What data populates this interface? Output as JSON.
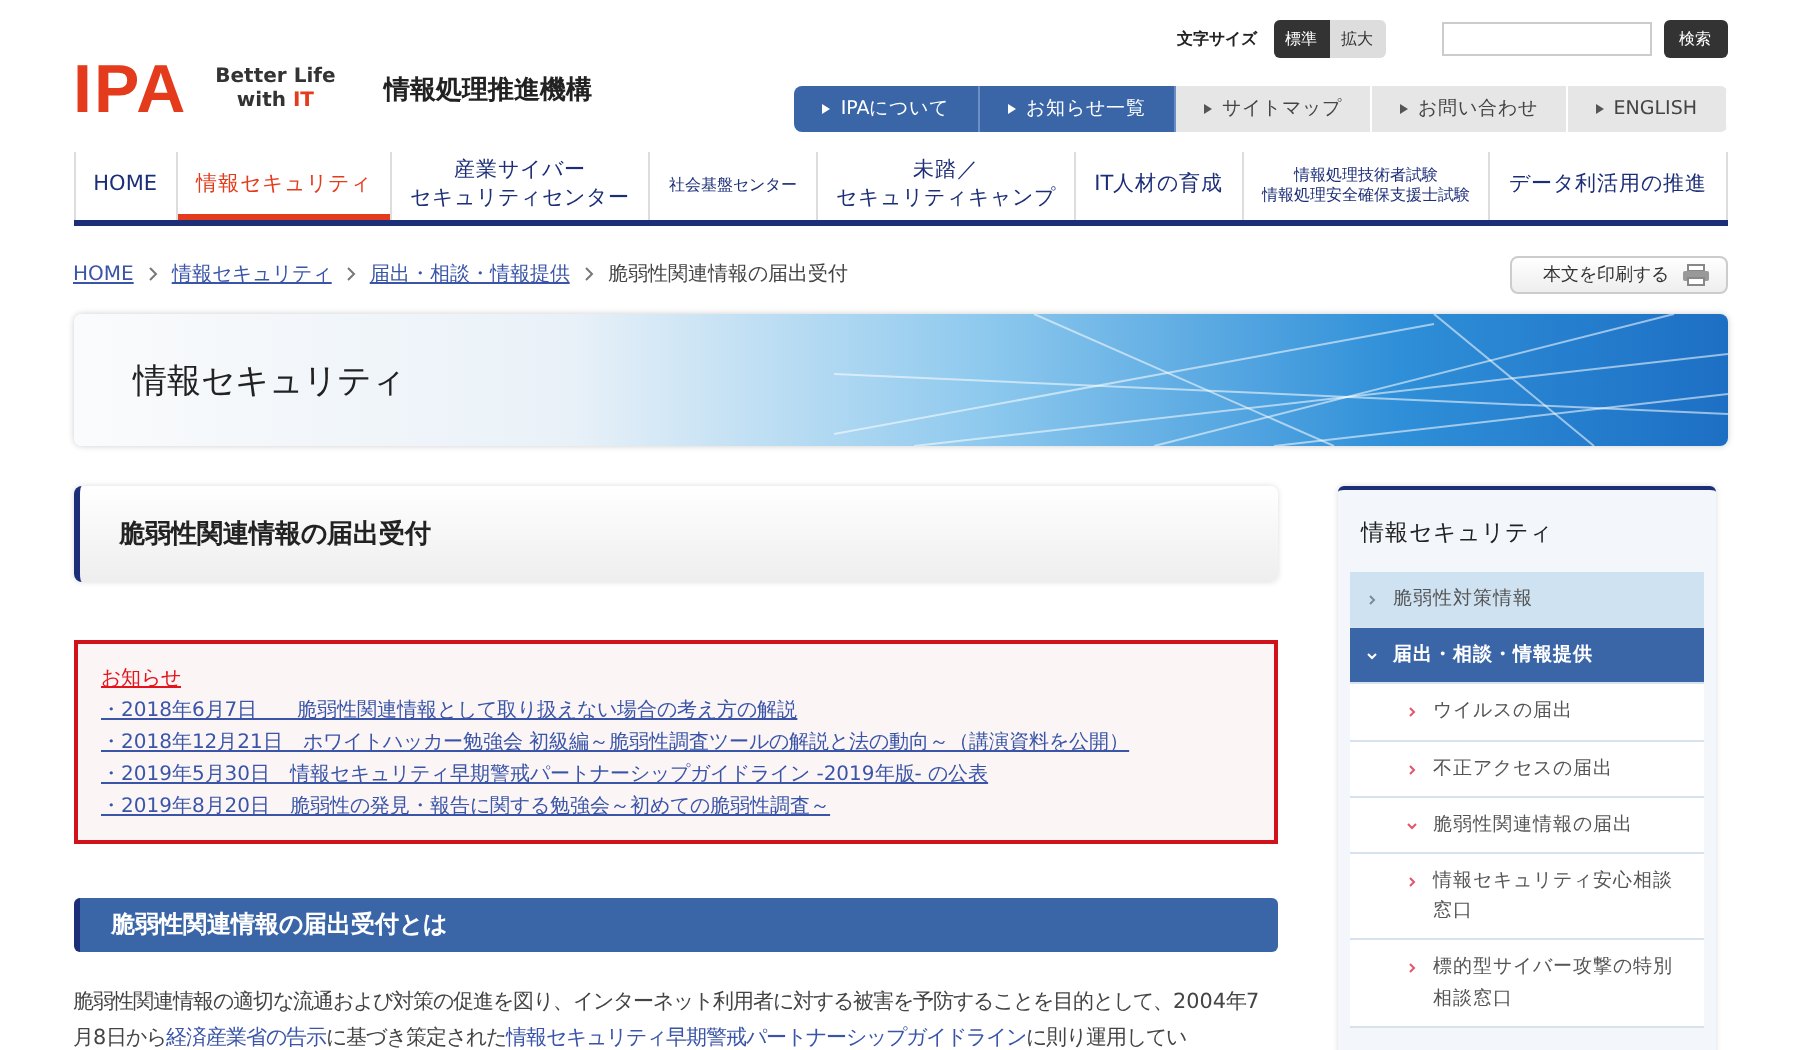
{
  "header": {
    "logo": {
      "mark": "IPA",
      "tagline_1": "Better Life",
      "tagline_2_prefix": "with ",
      "tagline_2_accent": "IT"
    },
    "org_name": "情報処理推進機構",
    "font_size": {
      "label": "文字サイズ",
      "options": [
        {
          "label": "標準",
          "selected": true
        },
        {
          "label": "拡大",
          "selected": false
        }
      ]
    },
    "search": {
      "button": "検索"
    },
    "links": [
      {
        "label": "IPAについて",
        "kind": "primary"
      },
      {
        "label": "お知らせ一覧",
        "kind": "primary"
      },
      {
        "label": "サイトマップ",
        "kind": "secondary"
      },
      {
        "label": "お問い合わせ",
        "kind": "secondary"
      },
      {
        "label": "ENGLISH",
        "kind": "secondary"
      }
    ]
  },
  "nav": [
    {
      "lines": [
        "HOME"
      ],
      "selected": false,
      "kind": "normal"
    },
    {
      "lines": [
        "情報セキュリティ"
      ],
      "selected": true,
      "kind": "normal"
    },
    {
      "lines": [
        "産業サイバー",
        "セキュリティセンター"
      ],
      "selected": false,
      "kind": "normal"
    },
    {
      "lines": [
        "社会基盤センター"
      ],
      "selected": false,
      "kind": "small"
    },
    {
      "lines": [
        "未踏／",
        "セキュリティキャンプ"
      ],
      "selected": false,
      "kind": "normal"
    },
    {
      "lines": [
        "IT人材の育成"
      ],
      "selected": false,
      "kind": "normal"
    },
    {
      "lines": [
        "情報処理技術者試験",
        "情報処理安全確保支援士試験"
      ],
      "selected": false,
      "kind": "small"
    },
    {
      "lines": [
        "データ利活用の推進"
      ],
      "selected": false,
      "kind": "normal"
    }
  ],
  "breadcrumb": [
    {
      "label": "HOME",
      "link": true
    },
    {
      "label": "情報セキュリティ",
      "link": true
    },
    {
      "label": "届出・相談・情報提供",
      "link": true
    },
    {
      "label": "脆弱性関連情報の届出受付",
      "link": false
    }
  ],
  "print_button": "本文を印刷する",
  "banner": {
    "title": "情報セキュリティ"
  },
  "page_title": "脆弱性関連情報の届出受付",
  "notice": {
    "title": "お知らせ",
    "items": [
      "・2018年6月7日　　脆弱性関連情報として取り扱えない場合の考え方の解説",
      "・2018年12月21日　ホワイトハッカー勉強会 初級編～脆弱性調査ツールの解説と法の動向～（講演資料を公開）",
      "・2019年5月30日　情報セキュリティ早期警戒パートナーシップガイドライン -2019年版- の公表",
      "・2019年8月20日　脆弱性の発見・報告に関する勉強会～初めての脆弱性調査～"
    ]
  },
  "section": {
    "heading": "脆弱性関連情報の届出受付とは",
    "paragraph": [
      {
        "text": "脆弱性関連情報の適切な流通および対策の促進を図り、インターネット利用者に対する被害を予防することを目的として、2004年7月8日から",
        "link": false
      },
      {
        "text": "経済産業省の告示",
        "link": true
      },
      {
        "text": "に基づき策定された",
        "link": false
      },
      {
        "text": "情報セキュリティ早期警戒パートナーシップガイドライン",
        "link": true
      },
      {
        "text": "に則り運用してい",
        "link": false
      }
    ]
  },
  "sidebar": {
    "title": "情報セキュリティ",
    "items": [
      {
        "label": "脆弱性対策情報",
        "expanded": false,
        "selected": false
      },
      {
        "label": "届出・相談・情報提供",
        "expanded": true,
        "selected": true,
        "children": [
          {
            "label": "ウイルスの届出",
            "expanded": false,
            "selected": false
          },
          {
            "label": "不正アクセスの届出",
            "expanded": false,
            "selected": false
          },
          {
            "label": "脆弱性関連情報の届出",
            "expanded": true,
            "selected": false
          },
          {
            "label": "情報セキュリティ安心相談窓口",
            "expanded": false,
            "selected": false
          },
          {
            "label": "標的型サイバー攻撃の特別相談窓口",
            "expanded": false,
            "selected": false
          }
        ]
      }
    ]
  }
}
